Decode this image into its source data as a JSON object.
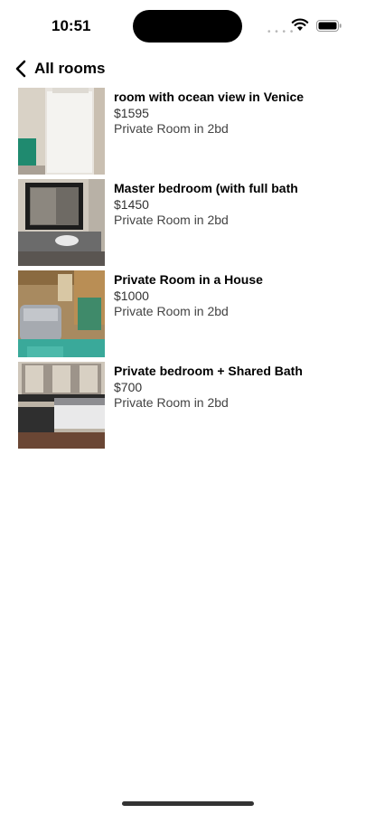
{
  "status_bar": {
    "time": "10:51",
    "signal_dots": "• • • •",
    "wifi_icon": "wifi-icon",
    "battery_icon": "battery-icon"
  },
  "nav": {
    "back_label": "All rooms",
    "back_icon": "chevron-left-icon"
  },
  "rooms": [
    {
      "title": "room with ocean view in Venice",
      "price": "$1595",
      "subtitle": "Private Room in 2bd"
    },
    {
      "title": "Master bedroom (with full bath",
      "price": "$1450",
      "subtitle": "Private Room in 2bd"
    },
    {
      "title": "Private Room in a House",
      "price": "$1000",
      "subtitle": "Private Room in 2bd"
    },
    {
      "title": "Private bedroom + Shared Bath",
      "price": "$700",
      "subtitle": "Private Room in 2bd"
    }
  ]
}
